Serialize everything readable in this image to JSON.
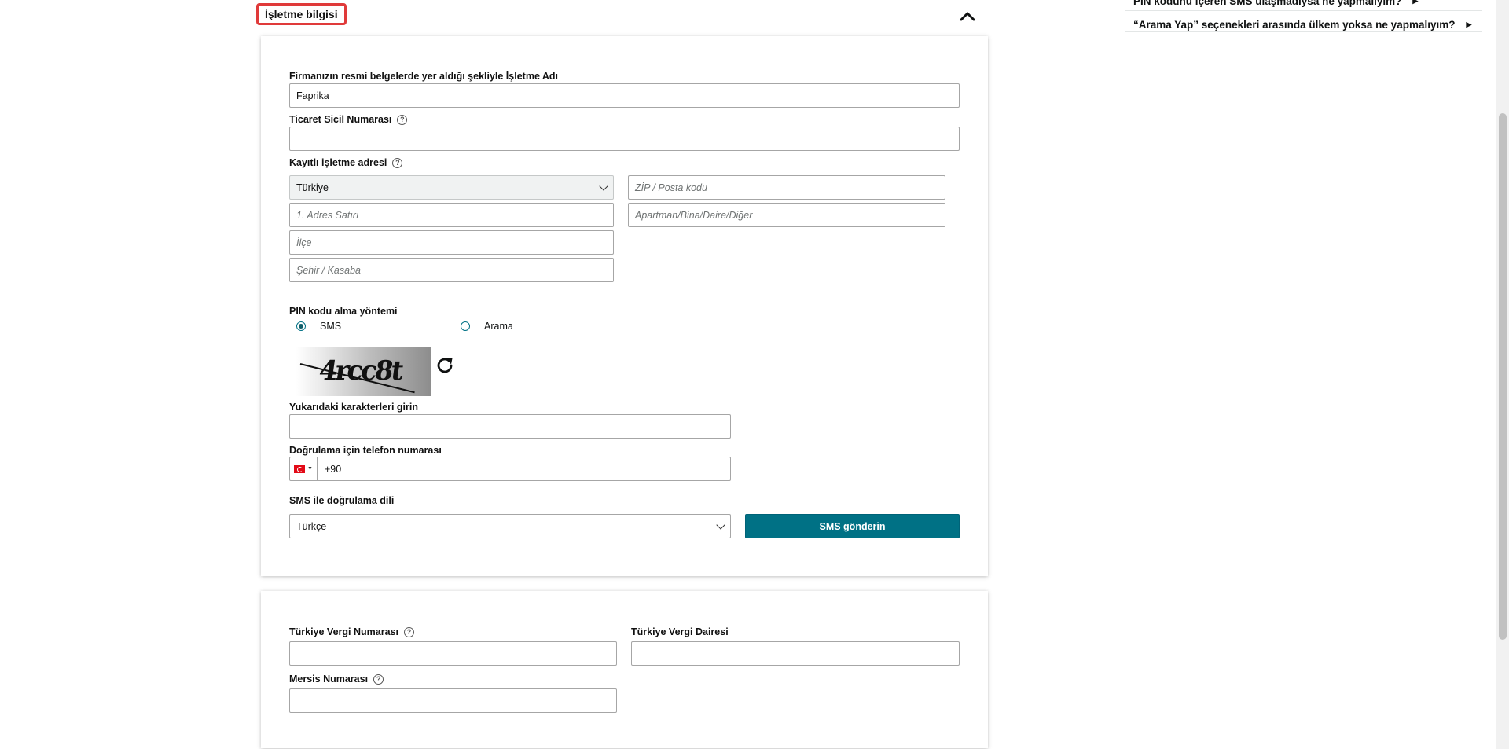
{
  "section": {
    "title": "İşletme bilgisi"
  },
  "help": {
    "items": [
      {
        "label": "PIN kodunu içeren SMS ulaşmadıysa ne yapmalıyım?"
      },
      {
        "label": "“Arama Yap” seçenekleri arasında ülkem yoksa ne yapmalıyım?"
      }
    ]
  },
  "form": {
    "business_name": {
      "label": "Firmanızın resmi belgelerde yer aldığı şekliyle İşletme Adı",
      "value": "Faprika"
    },
    "trade_registry": {
      "label": "Ticaret Sicil Numarası",
      "value": ""
    },
    "address": {
      "label": "Kayıtlı işletme adresi",
      "country": "Türkiye",
      "zip_placeholder": "ZİP / Posta kodu",
      "line1_placeholder": "1. Adres Satırı",
      "line2_placeholder": "Apartman/Bina/Daire/Diğer",
      "district_placeholder": "İlçe",
      "city_placeholder": "Şehir / Kasaba"
    },
    "pin_method": {
      "label": "PIN kodu alma yöntemi",
      "options": [
        {
          "label": "SMS",
          "selected": true
        },
        {
          "label": "Arama",
          "selected": false
        }
      ]
    },
    "captcha": {
      "text": "4rcc8t",
      "input_label": "Yukarıdaki karakterleri girin",
      "value": ""
    },
    "phone": {
      "label": "Doğrulama için telefon numarası",
      "value": "+90",
      "country_flag": "tr-flag-icon"
    },
    "sms_language": {
      "label": "SMS ile doğrulama dili",
      "value": "Türkçe"
    },
    "sms_button": "SMS gönderin",
    "tax_number": {
      "label": "Türkiye Vergi Numarası",
      "value": ""
    },
    "tax_office": {
      "label": "Türkiye Vergi Dairesi",
      "value": ""
    },
    "mersis": {
      "label": "Mersis Numarası",
      "value": ""
    }
  },
  "colors": {
    "accent": "#007185",
    "highlight_border": "#e03a3a"
  }
}
